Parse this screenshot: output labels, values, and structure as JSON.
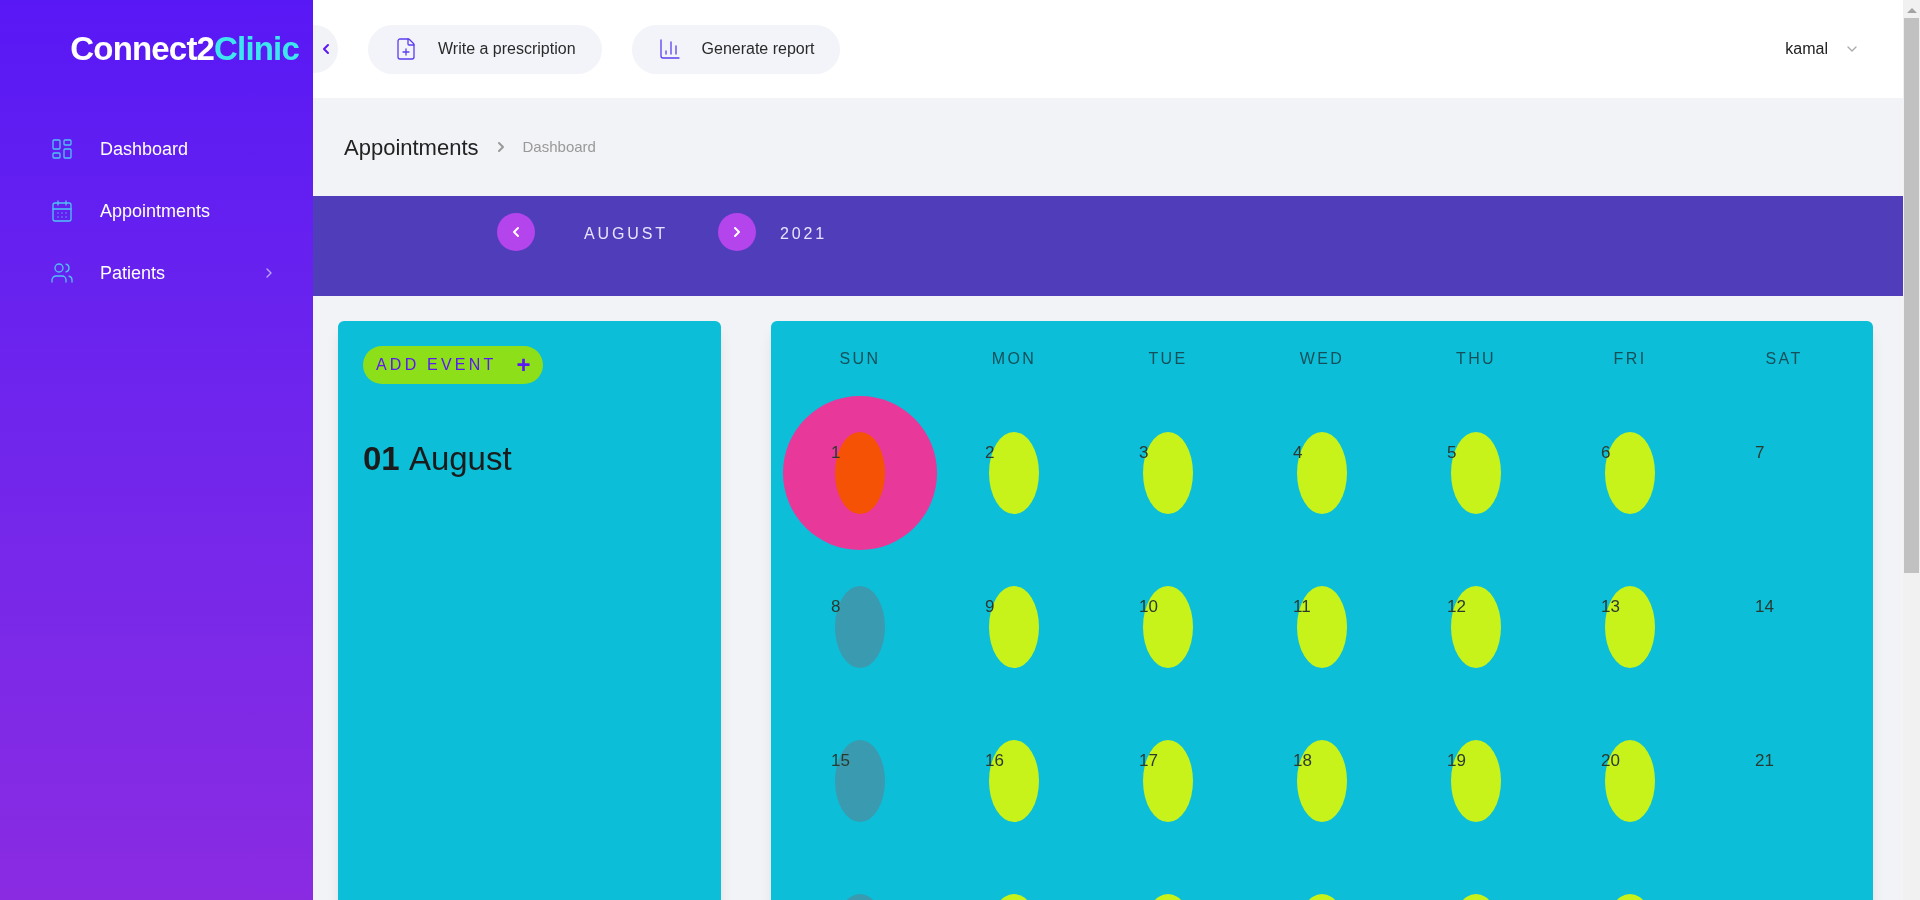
{
  "brand": {
    "part1": "Connect2",
    "part2": "Clinic"
  },
  "sidebar": {
    "items": [
      {
        "label": "Dashboard",
        "has_submenu": false
      },
      {
        "label": "Appointments",
        "has_submenu": false
      },
      {
        "label": "Patients",
        "has_submenu": true
      }
    ]
  },
  "header": {
    "actions": [
      {
        "label": "Write a prescription"
      },
      {
        "label": "Generate report"
      }
    ],
    "user": "kamal"
  },
  "breadcrumb": {
    "title": "Appointments",
    "trail": "Dashboard"
  },
  "month_nav": {
    "month": "AUGUST",
    "year": "2021"
  },
  "event_panel": {
    "add_button": "ADD EVENT",
    "plus": "+",
    "day": "01",
    "month": "August"
  },
  "calendar": {
    "weekdays": [
      "SUN",
      "MON",
      "TUE",
      "WED",
      "THU",
      "FRI",
      "SAT"
    ],
    "weeks": [
      [
        {
          "label": "1",
          "kind": "open",
          "selected": true
        },
        {
          "label": "2",
          "kind": "open",
          "selected": false
        },
        {
          "label": "3",
          "kind": "open",
          "selected": false
        },
        {
          "label": "4",
          "kind": "open",
          "selected": false
        },
        {
          "label": "5",
          "kind": "open",
          "selected": false
        },
        {
          "label": "6",
          "kind": "open",
          "selected": false
        },
        {
          "label": "7",
          "kind": "weekend",
          "selected": false
        }
      ],
      [
        {
          "label": "8",
          "kind": "past",
          "selected": false
        },
        {
          "label": "9",
          "kind": "open",
          "selected": false
        },
        {
          "label": "10",
          "kind": "open",
          "selected": false
        },
        {
          "label": "11",
          "kind": "open",
          "selected": false
        },
        {
          "label": "12",
          "kind": "open",
          "selected": false
        },
        {
          "label": "13",
          "kind": "open",
          "selected": false
        },
        {
          "label": "14",
          "kind": "weekend",
          "selected": false
        }
      ],
      [
        {
          "label": "15",
          "kind": "past",
          "selected": false
        },
        {
          "label": "16",
          "kind": "open",
          "selected": false
        },
        {
          "label": "17",
          "kind": "open",
          "selected": false
        },
        {
          "label": "18",
          "kind": "open",
          "selected": false
        },
        {
          "label": "19",
          "kind": "open",
          "selected": false
        },
        {
          "label": "20",
          "kind": "open",
          "selected": false
        },
        {
          "label": "21",
          "kind": "weekend",
          "selected": false
        }
      ],
      [
        {
          "kind": "past",
          "selected": false
        },
        {
          "kind": "open",
          "selected": false
        },
        {
          "kind": "open",
          "selected": false
        },
        {
          "kind": "open",
          "selected": false
        },
        {
          "kind": "open",
          "selected": false
        },
        {
          "kind": "open",
          "selected": false
        }
      ]
    ]
  }
}
